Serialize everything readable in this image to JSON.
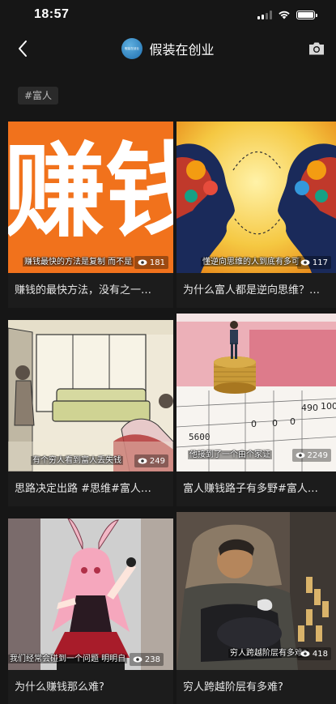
{
  "status_bar": {
    "time": "18:57"
  },
  "nav": {
    "title": "假装在创业",
    "avatar_text": "假装在创业",
    "back_icon": "chevron-left-icon",
    "camera_icon": "camera-icon"
  },
  "hashtag": "#富人",
  "cards": [
    {
      "subtitle": "赚钱最快的方法是复制 而不是",
      "views": "181",
      "caption": "赚钱的最快方法，没有之一…"
    },
    {
      "subtitle": "懂逆向思维的人到底有多可",
      "views": "117",
      "caption": "为什么富人都是逆向思维？…"
    },
    {
      "subtitle": "有个穷人看到富人丢失钱",
      "views": "249",
      "caption": "思路决定出路 #思维#富人…"
    },
    {
      "subtitle": "他接到了一个由个家证",
      "views": "2249",
      "caption": "富人赚钱路子有多野#富人…"
    },
    {
      "subtitle": "我们经常会碰到一个问题 明明自",
      "views": "238",
      "caption": "为什么赚钱那么难?"
    },
    {
      "subtitle": "穷人跨越阶层有多难?",
      "views": "418",
      "caption": "穷人跨越阶层有多难?"
    }
  ],
  "thumb_text": {
    "card1_big": "赚钱",
    "card4_table": [
      "5600",
      "0",
      "0",
      "0",
      "490",
      "100"
    ]
  }
}
